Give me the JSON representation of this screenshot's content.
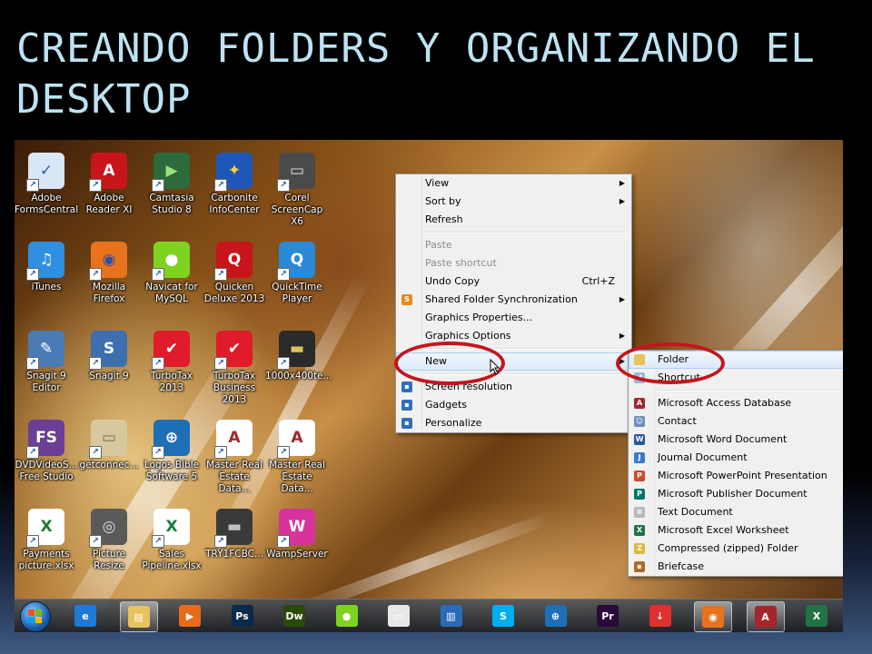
{
  "slide": {
    "title": "CREANDO FOLDERS Y ORGANIZANDO EL DESKTOP"
  },
  "desktop_icons": [
    {
      "label": "Adobe\nFormsCentral",
      "icon": "adobe-formscentral-icon",
      "color": "#d9e6f5",
      "glyph": "✓",
      "glyph_color": "#2a61b8"
    },
    {
      "label": "iTunes",
      "icon": "itunes-icon",
      "color": "#2f8fe0",
      "glyph": "♫",
      "glyph_color": "#ffffff"
    },
    {
      "label": "Snagit 9\nEditor",
      "icon": "snagit-editor-icon",
      "color": "#4a7bb5",
      "glyph": "✎",
      "glyph_color": "#ffffff"
    },
    {
      "label": "DVDVideoS...\nFree Studio",
      "icon": "dvdvideosoft-icon",
      "color": "#6a3f95",
      "glyph": "FS",
      "glyph_color": "#ffffff"
    },
    {
      "label": "Payments\npicture.xlsx",
      "icon": "excel-file-icon",
      "color": "#ffffff",
      "glyph": "X",
      "glyph_color": "#1e7a3a"
    },
    {
      "label": "Adobe\nReader XI",
      "icon": "adobe-reader-icon",
      "color": "#c8141b",
      "glyph": "A",
      "glyph_color": "#ffffff"
    },
    {
      "label": "Mozilla\nFirefox",
      "icon": "firefox-icon",
      "color": "#e8731c",
      "glyph": "◉",
      "glyph_color": "#2b4fa8"
    },
    {
      "label": "Snagit 9",
      "icon": "snagit-icon",
      "color": "#3d6fb0",
      "glyph": "S",
      "glyph_color": "#ffffff"
    },
    {
      "label": "getconnec...",
      "icon": "getconnected-icon",
      "color": "#d8c8a0",
      "glyph": "▭",
      "glyph_color": "#7a6a4a"
    },
    {
      "label": "Picture Resize",
      "icon": "camera-icon",
      "color": "#5a5a5a",
      "glyph": "◎",
      "glyph_color": "#dddddd"
    },
    {
      "label": "Camtasia\nStudio 8",
      "icon": "camtasia-icon",
      "color": "#2b6b3c",
      "glyph": "▶",
      "glyph_color": "#9fe07a"
    },
    {
      "label": "Navicat for\nMySQL",
      "icon": "navicat-icon",
      "color": "#7ed321",
      "glyph": "●",
      "glyph_color": "#ffffff"
    },
    {
      "label": "TurboTax\n2013",
      "icon": "turbotax-icon",
      "color": "#e01b2a",
      "glyph": "✔",
      "glyph_color": "#ffffff"
    },
    {
      "label": "Logos Bible\nSoftware 5",
      "icon": "logos-bible-icon",
      "color": "#1f6fb6",
      "glyph": "⊕",
      "glyph_color": "#ffffff"
    },
    {
      "label": "Sales\nPipeline.xlsx",
      "icon": "excel-file-icon",
      "color": "#ffffff",
      "glyph": "X",
      "glyph_color": "#1e7a3a"
    },
    {
      "label": "Carbonite\nInfoCenter",
      "icon": "carbonite-icon",
      "color": "#1f57b8",
      "glyph": "✦",
      "glyph_color": "#ffd23a"
    },
    {
      "label": "Quicken\nDeluxe 2013",
      "icon": "quicken-icon",
      "color": "#c8141b",
      "glyph": "Q",
      "glyph_color": "#ffffff"
    },
    {
      "label": "TurboTax\nBusiness 2013",
      "icon": "turbotax-business-icon",
      "color": "#e01b2a",
      "glyph": "✔",
      "glyph_color": "#ffffff"
    },
    {
      "label": "Master Real\nEstate Data...",
      "icon": "access-file-icon",
      "color": "#ffffff",
      "glyph": "A",
      "glyph_color": "#a4262c"
    },
    {
      "label": "TRY1FCBC...",
      "icon": "image-file-icon",
      "color": "#3a3a3a",
      "glyph": "▬",
      "glyph_color": "#c0c0c0"
    },
    {
      "label": "Corel\nScreenCap X6",
      "icon": "corel-screencap-icon",
      "color": "#4a4a4a",
      "glyph": "▭",
      "glyph_color": "#e0e0e0"
    },
    {
      "label": "QuickTime\nPlayer",
      "icon": "quicktime-icon",
      "color": "#2a8ad8",
      "glyph": "Q",
      "glyph_color": "#ffffff"
    },
    {
      "label": "1000x400te...",
      "icon": "image-file-icon",
      "color": "#2a2a2a",
      "glyph": "▬",
      "glyph_color": "#e0c060"
    },
    {
      "label": "Master Real\nEstate Data...",
      "icon": "access-file-icon",
      "color": "#ffffff",
      "glyph": "A",
      "glyph_color": "#a4262c"
    },
    {
      "label": "WampServer",
      "icon": "wampserver-icon",
      "color": "#d6339b",
      "glyph": "W",
      "glyph_color": "#ffffff"
    }
  ],
  "context_menu": {
    "items": [
      {
        "label": "View",
        "type": "item",
        "submenu": true
      },
      {
        "label": "Sort by",
        "type": "item",
        "submenu": true
      },
      {
        "label": "Refresh",
        "type": "item"
      },
      {
        "type": "separator"
      },
      {
        "label": "Paste",
        "type": "item",
        "disabled": true
      },
      {
        "label": "Paste shortcut",
        "type": "item",
        "disabled": true
      },
      {
        "label": "Undo Copy",
        "type": "item",
        "shortcut": "Ctrl+Z"
      },
      {
        "label": "Shared Folder Synchronization",
        "type": "item",
        "submenu": true,
        "icon": "sync-icon",
        "icon_color": "#e88a1a",
        "icon_glyph": "S"
      },
      {
        "label": "Graphics Properties...",
        "type": "item"
      },
      {
        "label": "Graphics Options",
        "type": "item",
        "submenu": true
      },
      {
        "type": "separator"
      },
      {
        "label": "New",
        "type": "item",
        "submenu": true,
        "highlighted": true
      },
      {
        "type": "separator"
      },
      {
        "label": "Screen resolution",
        "type": "item",
        "icon": "screen-resolution-icon",
        "icon_color": "#2f6fb8",
        "icon_glyph": "▪"
      },
      {
        "label": "Gadgets",
        "type": "item",
        "icon": "gadgets-icon",
        "icon_color": "#2f6fb8",
        "icon_glyph": "▪"
      },
      {
        "label": "Personalize",
        "type": "item",
        "icon": "personalize-icon",
        "icon_color": "#2f6fb8",
        "icon_glyph": "▪"
      }
    ]
  },
  "new_submenu": {
    "items": [
      {
        "label": "Folder",
        "type": "item",
        "highlighted": true,
        "icon": "folder-icon",
        "icon_color": "#e8c25a",
        "icon_glyph": ""
      },
      {
        "label": "Shortcut",
        "type": "item",
        "icon": "shortcut-icon",
        "icon_color": "#9ab8d8",
        "icon_glyph": "↗"
      },
      {
        "type": "separator"
      },
      {
        "label": "Microsoft Access Database",
        "type": "item",
        "icon": "access-icon",
        "icon_color": "#a4262c",
        "icon_glyph": "A"
      },
      {
        "label": "Contact",
        "type": "item",
        "icon": "contact-icon",
        "icon_color": "#6d8fb8",
        "icon_glyph": "☺"
      },
      {
        "label": "Microsoft Word Document",
        "type": "item",
        "icon": "word-icon",
        "icon_color": "#2b579a",
        "icon_glyph": "W"
      },
      {
        "label": "Journal Document",
        "type": "item",
        "icon": "journal-icon",
        "icon_color": "#3a7bc8",
        "icon_glyph": "J"
      },
      {
        "label": "Microsoft PowerPoint Presentation",
        "type": "item",
        "icon": "powerpoint-icon",
        "icon_color": "#d24726",
        "icon_glyph": "P"
      },
      {
        "label": "Microsoft Publisher Document",
        "type": "item",
        "icon": "publisher-icon",
        "icon_color": "#077568",
        "icon_glyph": "P"
      },
      {
        "label": "Text Document",
        "type": "item",
        "icon": "text-document-icon",
        "icon_color": "#b8b8b8",
        "icon_glyph": "≡"
      },
      {
        "label": "Microsoft Excel Worksheet",
        "type": "item",
        "icon": "excel-icon",
        "icon_color": "#217346",
        "icon_glyph": "X"
      },
      {
        "label": "Compressed (zipped) Folder",
        "type": "item",
        "icon": "zip-folder-icon",
        "icon_color": "#e0b840",
        "icon_glyph": "Z"
      },
      {
        "label": "Briefcase",
        "type": "item",
        "icon": "briefcase-icon",
        "icon_color": "#b06a2a",
        "icon_glyph": "▪"
      }
    ]
  },
  "taskbar": {
    "items": [
      {
        "icon": "internet-explorer-icon",
        "color": "#1f7ad6",
        "glyph": "e",
        "active": false
      },
      {
        "icon": "windows-explorer-icon",
        "color": "#e8c25a",
        "glyph": "▤",
        "active": true
      },
      {
        "icon": "media-player-icon",
        "color": "#e86a1a",
        "glyph": "▶",
        "active": false
      },
      {
        "icon": "photoshop-icon",
        "color": "#0a2a4a",
        "glyph": "Ps",
        "active": false
      },
      {
        "icon": "dreamweaver-icon",
        "color": "#2a4a0a",
        "glyph": "Dw",
        "active": false
      },
      {
        "icon": "navicat-icon",
        "color": "#7ed321",
        "glyph": "●",
        "active": false
      },
      {
        "icon": "window-app-icon",
        "color": "#e8e8e8",
        "glyph": "▭",
        "active": false
      },
      {
        "icon": "book-app-icon",
        "color": "#2a6ab8",
        "glyph": "▥",
        "active": false
      },
      {
        "icon": "skype-icon",
        "color": "#00aff0",
        "glyph": "S",
        "active": false
      },
      {
        "icon": "logos-bible-icon",
        "color": "#1f6fb6",
        "glyph": "⊕",
        "active": false
      },
      {
        "icon": "premiere-icon",
        "color": "#2a0a3a",
        "glyph": "Pr",
        "active": false
      },
      {
        "icon": "download-icon",
        "color": "#e03030",
        "glyph": "↓",
        "active": false
      },
      {
        "icon": "firefox-icon",
        "color": "#e8731c",
        "glyph": "◉",
        "active": true
      },
      {
        "icon": "access-icon",
        "color": "#a4262c",
        "glyph": "A",
        "active": true
      },
      {
        "icon": "excel-icon",
        "color": "#217346",
        "glyph": "X",
        "active": false
      }
    ]
  },
  "colors": {
    "title": "#bde3f2",
    "annotation_circle": "#c4151c",
    "menu_background": "#f0f0f0"
  }
}
